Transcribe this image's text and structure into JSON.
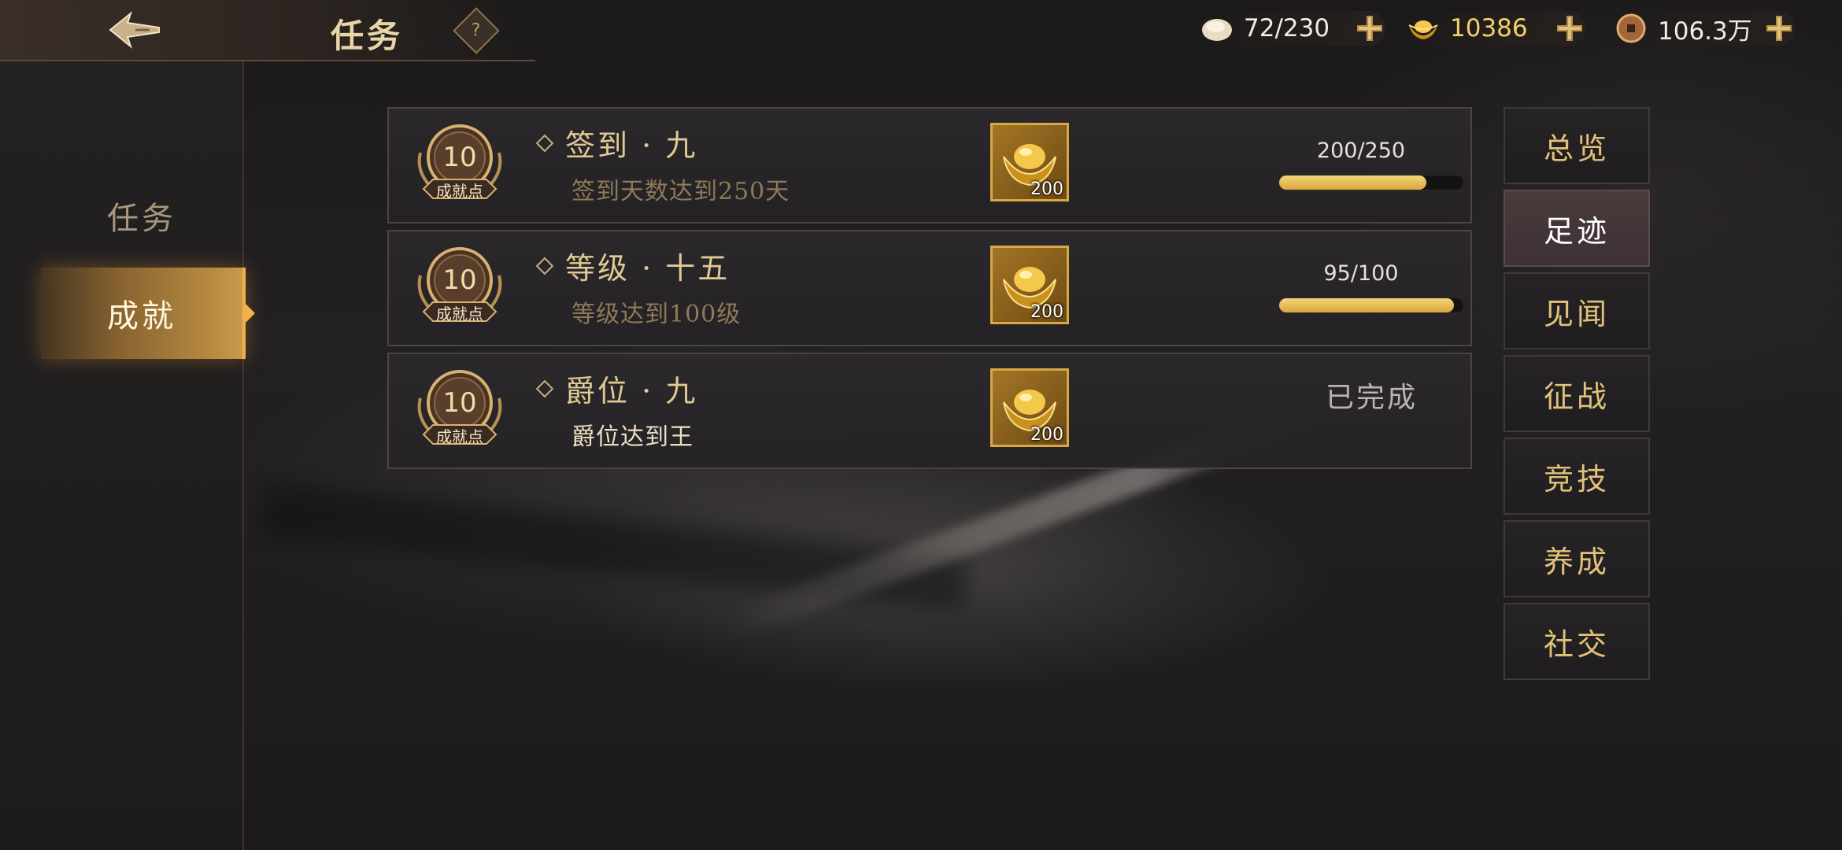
{
  "header": {
    "title": "任务",
    "help_label": "?",
    "resources": [
      {
        "icon": "food-bun-icon",
        "value": "72/230"
      },
      {
        "icon": "gold-ingot-icon",
        "value": "10386"
      },
      {
        "icon": "copper-coin-icon",
        "value": "106.3万"
      }
    ]
  },
  "sidebar": {
    "tabs": [
      {
        "label": "任务",
        "active": false
      },
      {
        "label": "成就",
        "active": true
      }
    ]
  },
  "achievements": [
    {
      "points": "10",
      "points_label": "成就点",
      "title": "签到 · 九",
      "description": "签到天数达到250天",
      "reward_icon": "gold-ingot-icon",
      "reward_qty": "200",
      "progress_text": "200/250",
      "progress": 0.8
    },
    {
      "points": "10",
      "points_label": "成就点",
      "title": "等级 · 十五",
      "description": "等级达到100级",
      "reward_icon": "gold-ingot-icon",
      "reward_qty": "200",
      "progress_text": "95/100",
      "progress": 0.95
    },
    {
      "points": "10",
      "points_label": "成就点",
      "title": "爵位 · 九",
      "description": "爵位达到王",
      "reward_icon": "gold-ingot-icon",
      "reward_qty": "200",
      "status_text": "已完成"
    }
  ],
  "categories": [
    {
      "label": "总览",
      "active": false
    },
    {
      "label": "足迹",
      "active": true
    },
    {
      "label": "见闻",
      "active": false
    },
    {
      "label": "征战",
      "active": false
    },
    {
      "label": "竞技",
      "active": false
    },
    {
      "label": "养成",
      "active": false
    },
    {
      "label": "社交",
      "active": false
    }
  ],
  "colors": {
    "accent_gold": "#d9a63a",
    "title_gold": "#e0c993",
    "active_category_bg": "#4a3a3c"
  }
}
